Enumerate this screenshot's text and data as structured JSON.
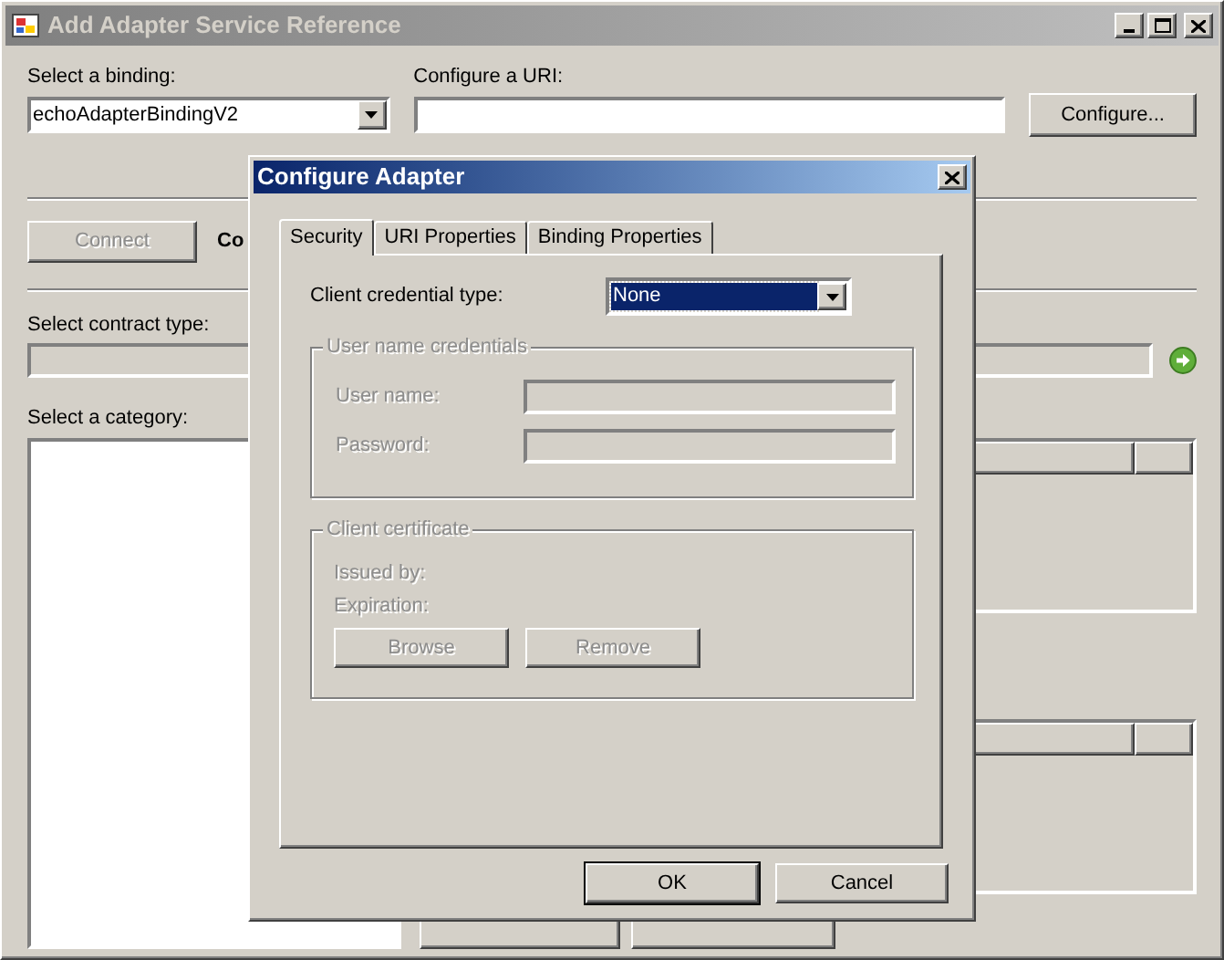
{
  "window": {
    "title": "Add Adapter Service Reference"
  },
  "binding": {
    "label": "Select a binding:",
    "value": "echoAdapterBindingV2"
  },
  "uri": {
    "label": "Configure a URI:",
    "button": "Configure..."
  },
  "connect": {
    "label": "Connect",
    "disabled": true
  },
  "connection_status": {
    "text": "Co"
  },
  "contract_type": {
    "label": "Select contract type:"
  },
  "category": {
    "label": "Select a category:"
  },
  "dialog": {
    "title": "Configure Adapter",
    "tabs": [
      {
        "label": "Security",
        "selected": true
      },
      {
        "label": "URI Properties",
        "selected": false
      },
      {
        "label": "Binding Properties",
        "selected": false
      }
    ],
    "credential_type": {
      "label": "Client credential type:",
      "value": "None"
    },
    "user_name_group": {
      "title": "User name credentials",
      "disabled": true,
      "fields": [
        {
          "label": "User name:"
        },
        {
          "label": "Password:"
        }
      ]
    },
    "certificate_group": {
      "title": "Client certificate",
      "disabled": true,
      "rows": [
        "Issued by:",
        "Expiration:"
      ],
      "buttons": [
        "Browse",
        "Remove"
      ]
    },
    "buttons": [
      {
        "label": "OK",
        "default": true
      },
      {
        "label": "Cancel",
        "default": false
      }
    ]
  }
}
